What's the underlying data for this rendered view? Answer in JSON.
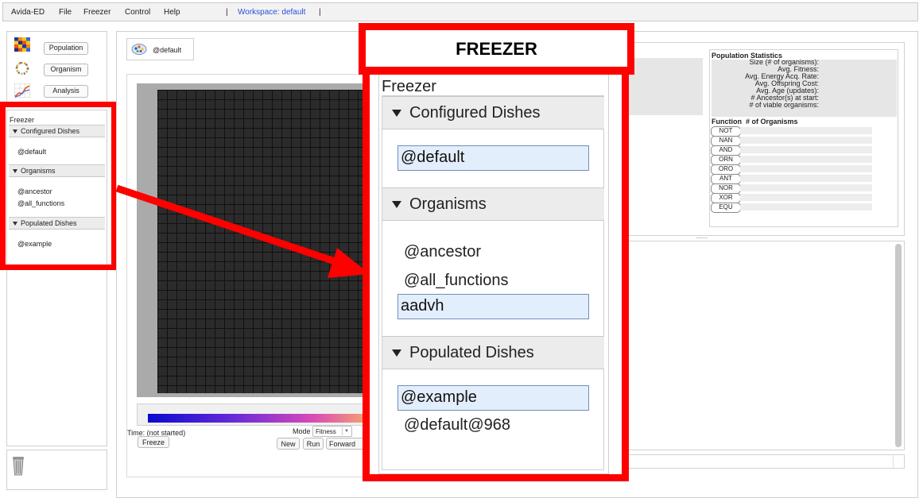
{
  "menubar": {
    "items": [
      "Avida-ED",
      "File",
      "Freezer",
      "Control",
      "Help"
    ],
    "sep1": "|",
    "workspace": "Workspace: default",
    "sep2": "|"
  },
  "nav": {
    "population": "Population",
    "organism": "Organism",
    "analysis": "Analysis"
  },
  "freezer_small": {
    "title": "Freezer",
    "configured": {
      "label": "Configured Dishes",
      "items": [
        "@default"
      ]
    },
    "organisms": {
      "label": "Organisms",
      "items": [
        "@ancestor",
        "@all_functions"
      ]
    },
    "populated": {
      "label": "Populated Dishes",
      "items": [
        "@example"
      ]
    }
  },
  "population": {
    "dish_name": "@default",
    "time": "Time: (not started)",
    "mode_label": "Mode",
    "mode_value": "Fitness",
    "buttons": {
      "freeze": "Freeze",
      "new": "New",
      "run": "Run",
      "forward": "Forward"
    }
  },
  "stats": {
    "title": "Population Statistics",
    "labels": [
      "Size (# of organisms):",
      "Avg. Fitness:",
      "Avg. Energy Acq. Rate:",
      "Avg. Offspring Cost:",
      "Avg. Age (updates):",
      "# Ancestor(s) at start:",
      "# of viable organisms:"
    ],
    "function_header": "Function  # of Organisms",
    "functions": [
      "NOT",
      "NAN",
      "AND",
      "ORN",
      "ORO",
      "ANT",
      "NOR",
      "XOR",
      "EQU"
    ]
  },
  "freezer_zoom": {
    "banner": "FREEZER",
    "title": "Freezer",
    "configured": {
      "label": "Configured Dishes",
      "items": [
        "@default"
      ]
    },
    "organisms": {
      "label": "Organisms",
      "items": [
        "@ancestor",
        "@all_functions",
        "aadvh"
      ]
    },
    "populated": {
      "label": "Populated Dishes",
      "items": [
        "@example",
        "@default@968"
      ]
    }
  },
  "colors": {
    "highlight": "#ff0000",
    "selection": "#e3eefc",
    "grid_cell": "#2b2b2b",
    "grid_line": "#111111"
  }
}
